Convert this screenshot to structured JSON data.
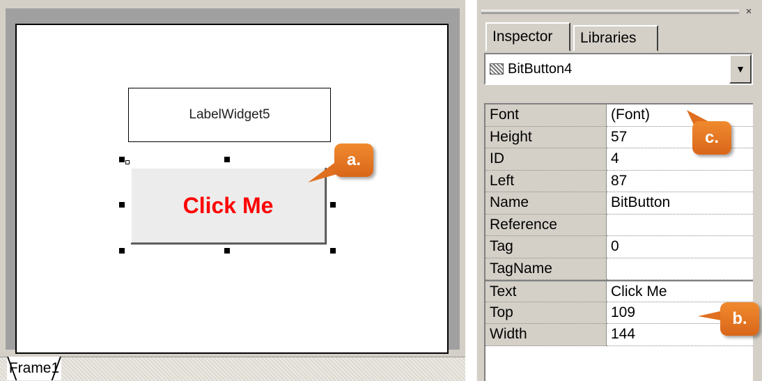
{
  "designer": {
    "label_widget_text": "LabelWidget5",
    "button_text": "Click Me",
    "button_text_color": "#ff0000",
    "frame_tab": "Frame1"
  },
  "inspector": {
    "close_glyph": "×",
    "tabs": [
      "Inspector",
      "Libraries"
    ],
    "active_tab": "Inspector",
    "selected_object": "BitButton4",
    "dropdown_glyph": "▼",
    "properties": [
      {
        "key": "Font",
        "value": "(Font)"
      },
      {
        "key": "Height",
        "value": "57"
      },
      {
        "key": "ID",
        "value": "4"
      },
      {
        "key": "Left",
        "value": "87"
      },
      {
        "key": "Name",
        "value": "BitButton"
      },
      {
        "key": "Reference",
        "value": ""
      },
      {
        "key": "Tag",
        "value": "0"
      },
      {
        "key": "TagName",
        "value": ""
      },
      {
        "key": "Text",
        "value": "Click Me"
      },
      {
        "key": "Top",
        "value": "109"
      },
      {
        "key": "Width",
        "value": "144"
      }
    ]
  },
  "callouts": {
    "a": "a.",
    "b": "b.",
    "c": "c.",
    "color": "#e8772a"
  },
  "icons": [
    "bitbutton-type-icon",
    "dropdown-arrow-icon",
    "close-icon"
  ]
}
